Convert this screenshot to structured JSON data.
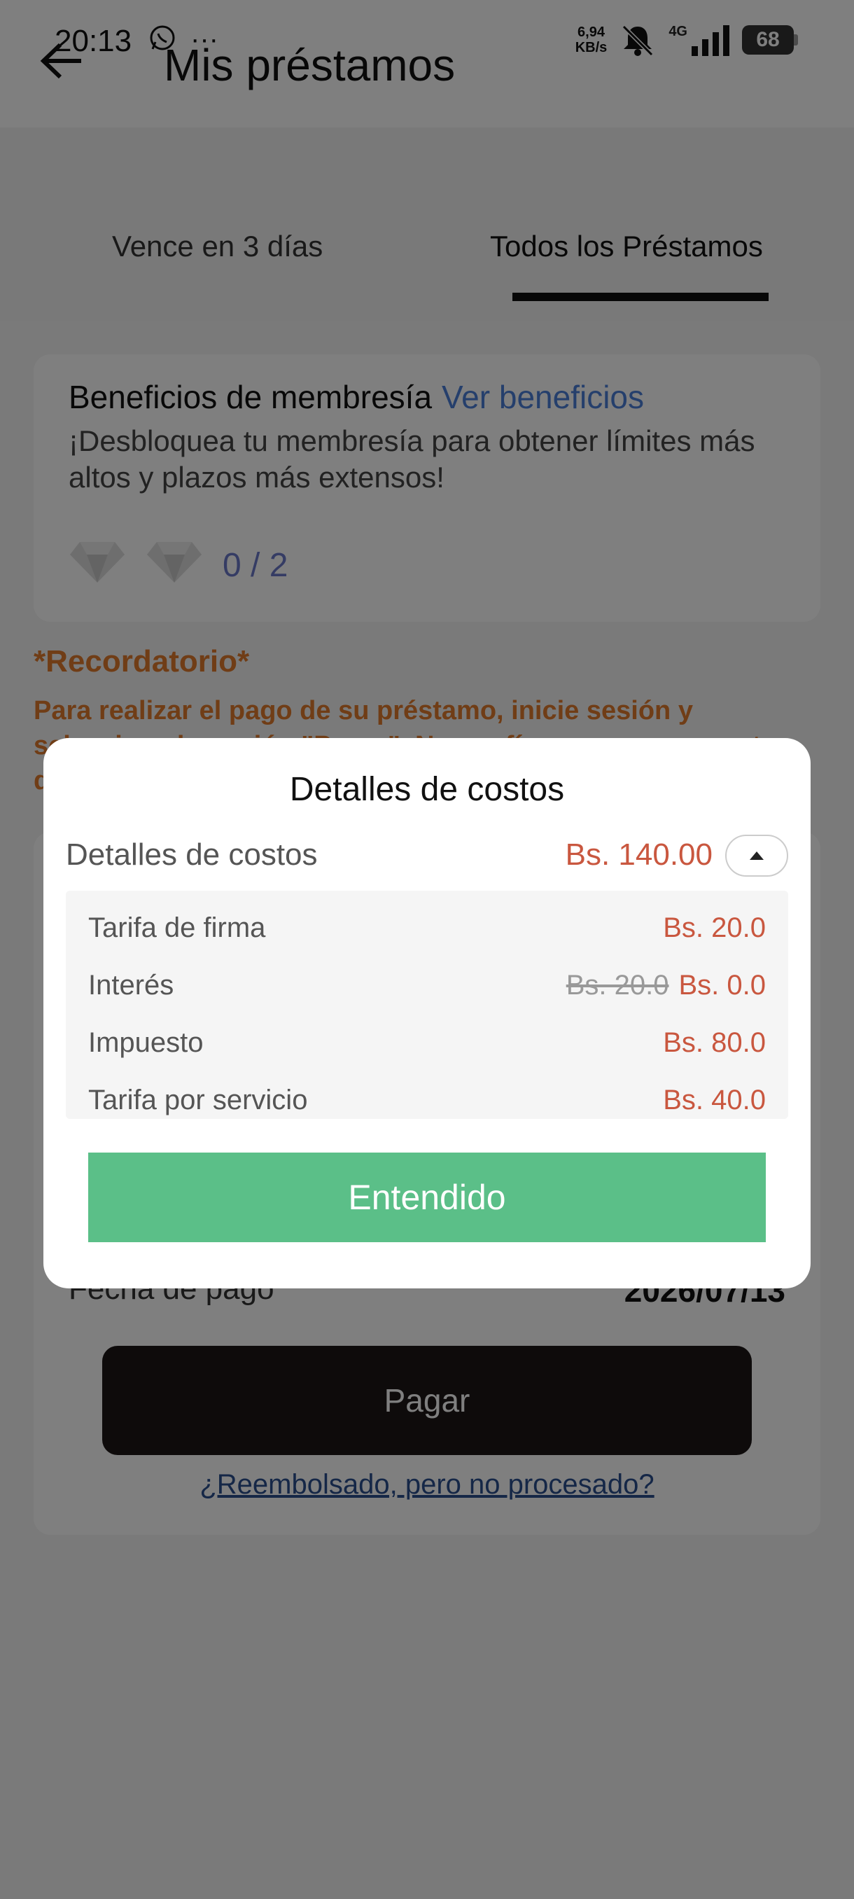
{
  "status_bar": {
    "time": "20:13",
    "left_icons": [
      "whatsapp-icon",
      "more-dots-icon"
    ],
    "net_speed_value": "6,94",
    "net_speed_unit": "KB/s",
    "network": "4G",
    "battery": "68"
  },
  "header": {
    "title": "Mis préstamos"
  },
  "tabs": [
    {
      "label": "Vence en 3 días",
      "active": false
    },
    {
      "label": "Todos los Préstamos",
      "active": true
    }
  ],
  "membership": {
    "title": "Beneficios de membresía",
    "link": "Ver beneficios",
    "description": "¡Desbloquea tu membresía para obtener límites más altos y plazos más extensos!",
    "count": "0 / 2"
  },
  "reminder": {
    "title": "*Recordatorio*",
    "text": "Para realizar el pago de su préstamo, inicie sesión y seleccione la opción \"Pagar\". No confíe en pagos a cuentas de terceros."
  },
  "loan": {
    "pay_date_label": "Fecha de pago",
    "pay_date_value": "2026/07/13",
    "pay_button": "Pagar",
    "refund_link": "¿Reembolsado, pero no procesado?"
  },
  "modal": {
    "title": "Detalles de costos",
    "summary_label": "Detalles de costos",
    "summary_value": "Bs. 140.00",
    "rows": [
      {
        "name": "Tarifa de firma",
        "original": "",
        "value": "Bs. 20.0"
      },
      {
        "name": "Interés",
        "original": "Bs. 20.0",
        "value": "Bs. 0.0"
      },
      {
        "name": "Impuesto",
        "original": "",
        "value": "Bs. 80.0"
      },
      {
        "name": "Tarifa por servicio",
        "original": "",
        "value": "Bs. 40.0"
      }
    ],
    "ok_button": "Entendido"
  },
  "colors": {
    "accent_green": "#5bbf88",
    "price_red": "#c9573f",
    "reminder_orange": "#e07b2d",
    "link_blue": "#4a7fd8"
  }
}
